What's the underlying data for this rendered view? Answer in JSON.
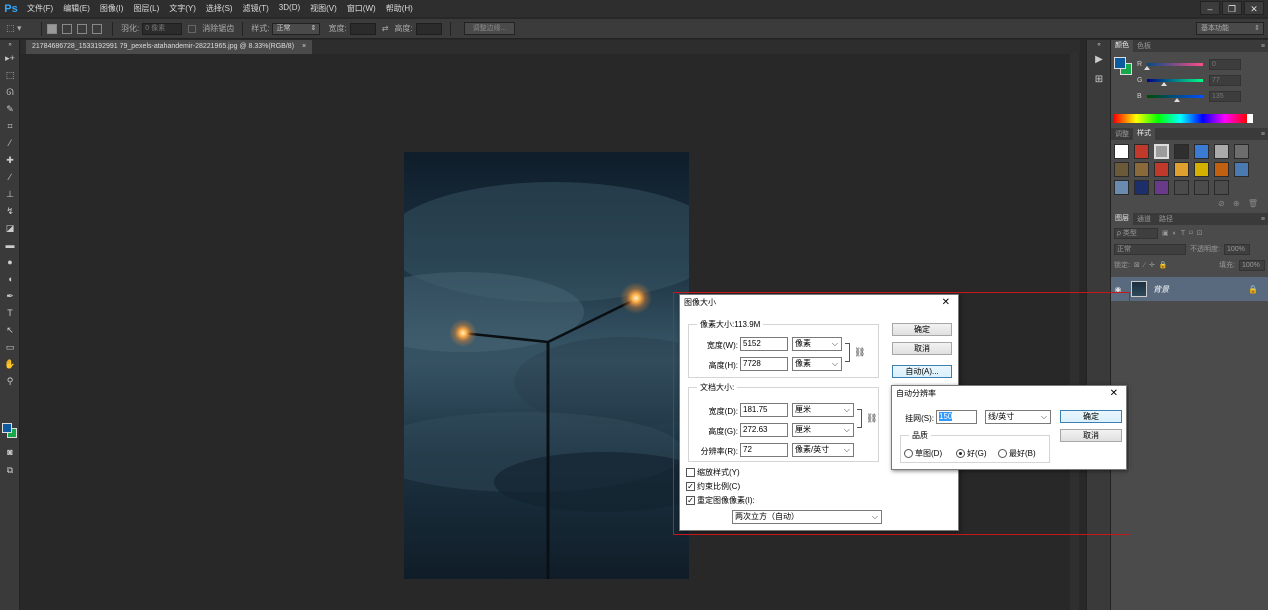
{
  "app": {
    "logo": "Ps"
  },
  "menu": [
    "文件(F)",
    "编辑(E)",
    "图像(I)",
    "图层(L)",
    "文字(Y)",
    "选择(S)",
    "滤镜(T)",
    "3D(D)",
    "视图(V)",
    "窗口(W)",
    "帮助(H)"
  ],
  "window_buttons": {
    "minimize": "–",
    "restore": "❐",
    "close": "✕"
  },
  "options": {
    "feather_label": "羽化:",
    "feather_value": "0 像素",
    "antialias_label": "消除锯齿",
    "style_label": "样式:",
    "style_value": "正常",
    "width_label": "宽度:",
    "height_label": "高度:",
    "refine_edge": "调整边缘...",
    "workspace": "基本功能"
  },
  "document": {
    "tab": "21784686728_1533192991 79_pexels-atahandemir-28221965.jpg @ 8.33%(RGB/8)",
    "close": "×"
  },
  "panels": {
    "color_tabs": [
      "颜色",
      "色板"
    ],
    "rgb": [
      {
        "label": "R",
        "value": "0",
        "pos": 0.0
      },
      {
        "label": "G",
        "value": "77",
        "pos": 0.3
      },
      {
        "label": "B",
        "value": "135",
        "pos": 0.53
      }
    ],
    "styles_tabs": [
      "调整",
      "样式"
    ],
    "layers_tabs": [
      "图层",
      "通道",
      "路径"
    ],
    "kind_filter": "ρ 类型",
    "blend_mode": "正常",
    "opacity_label": "不透明度:",
    "opacity_value": "100%",
    "lock_label": "锁定:",
    "fill_label": "填充:",
    "fill_value": "100%",
    "layer_name": "背景"
  },
  "image_size": {
    "title": "图像大小",
    "pixel_dims": "像素大小:113.9M",
    "width_label": "宽度(W):",
    "width_value": "5152",
    "width_unit": "像素",
    "height_label": "高度(H):",
    "height_value": "7728",
    "height_unit": "像素",
    "doc_size": "文档大小:",
    "doc_width_label": "宽度(D):",
    "doc_width_value": "181.75",
    "doc_width_unit": "厘米",
    "doc_height_label": "高度(G):",
    "doc_height_value": "272.63",
    "doc_height_unit": "厘米",
    "resolution_label": "分辨率(R):",
    "resolution_value": "72",
    "resolution_unit": "像素/英寸",
    "scale_styles": "缩放样式(Y)",
    "scale_styles_checked": false,
    "constrain": "约束比例(C)",
    "constrain_checked": true,
    "resample": "重定图像像素(I):",
    "resample_checked": true,
    "resample_method": "两次立方（自动）",
    "ok": "确定",
    "cancel": "取消",
    "auto": "自动(A)..."
  },
  "auto_resolution": {
    "title": "自动分辨率",
    "screen_label": "挂网(S):",
    "screen_value": "150",
    "screen_unit": "线/英寸",
    "quality_label": "品质",
    "quality_options": [
      "草图(D)",
      "好(G)",
      "最好(B)"
    ],
    "quality_selected": 1,
    "ok": "确定",
    "cancel": "取消"
  }
}
